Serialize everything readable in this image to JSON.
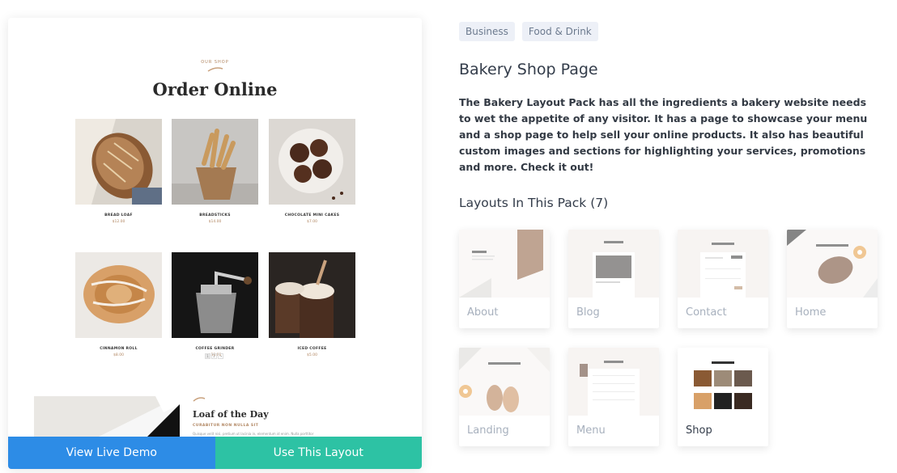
{
  "preview": {
    "eyebrow": "OUR SHOP",
    "title": "Order Online",
    "products": [
      {
        "name": "BREAD LOAF",
        "price": "$12.00"
      },
      {
        "name": "BREADSTICKS",
        "price": "$14.00"
      },
      {
        "name": "CHOCOLATE MINI CAKES",
        "price": "$7.00"
      },
      {
        "name": "CINNAMON ROLL",
        "price": "$8.00"
      },
      {
        "name": "COFFEE GRINDER",
        "price": "$30.00"
      },
      {
        "name": "ICED COFFEE",
        "price": "$5.00"
      }
    ],
    "pager": [
      "1",
      "2",
      "→"
    ],
    "feature": {
      "title": "Loaf of the Day",
      "subtitle": "CURABITUR NON NULLA SIT",
      "text": "Quisque velit nisi, pretium ut lacinia in, elementum id enim. Nulla porttitor"
    },
    "buttons": {
      "live_demo": "View Live Demo",
      "use_layout": "Use This Layout"
    }
  },
  "tags": [
    "Business",
    "Food & Drink"
  ],
  "title": "Bakery Shop Page",
  "description": "The Bakery Layout Pack has all the ingredients a bakery website needs to wet the appetite of any visitor. It has a page to showcase your menu and a shop page to help sell your online products. It also has beautiful custom images and sections for highlighting your services, promotions and more. Check it out!",
  "layouts_heading": "Layouts In This Pack (7)",
  "layouts": [
    {
      "label": "About",
      "active": false
    },
    {
      "label": "Blog",
      "active": false
    },
    {
      "label": "Contact",
      "active": false
    },
    {
      "label": "Home",
      "active": false
    },
    {
      "label": "Landing",
      "active": false
    },
    {
      "label": "Menu",
      "active": false
    },
    {
      "label": "Shop",
      "active": true
    }
  ],
  "colors": {
    "demo_button": "#2d8ce6",
    "use_button": "#2dc2a4",
    "accent": "#b08560"
  }
}
